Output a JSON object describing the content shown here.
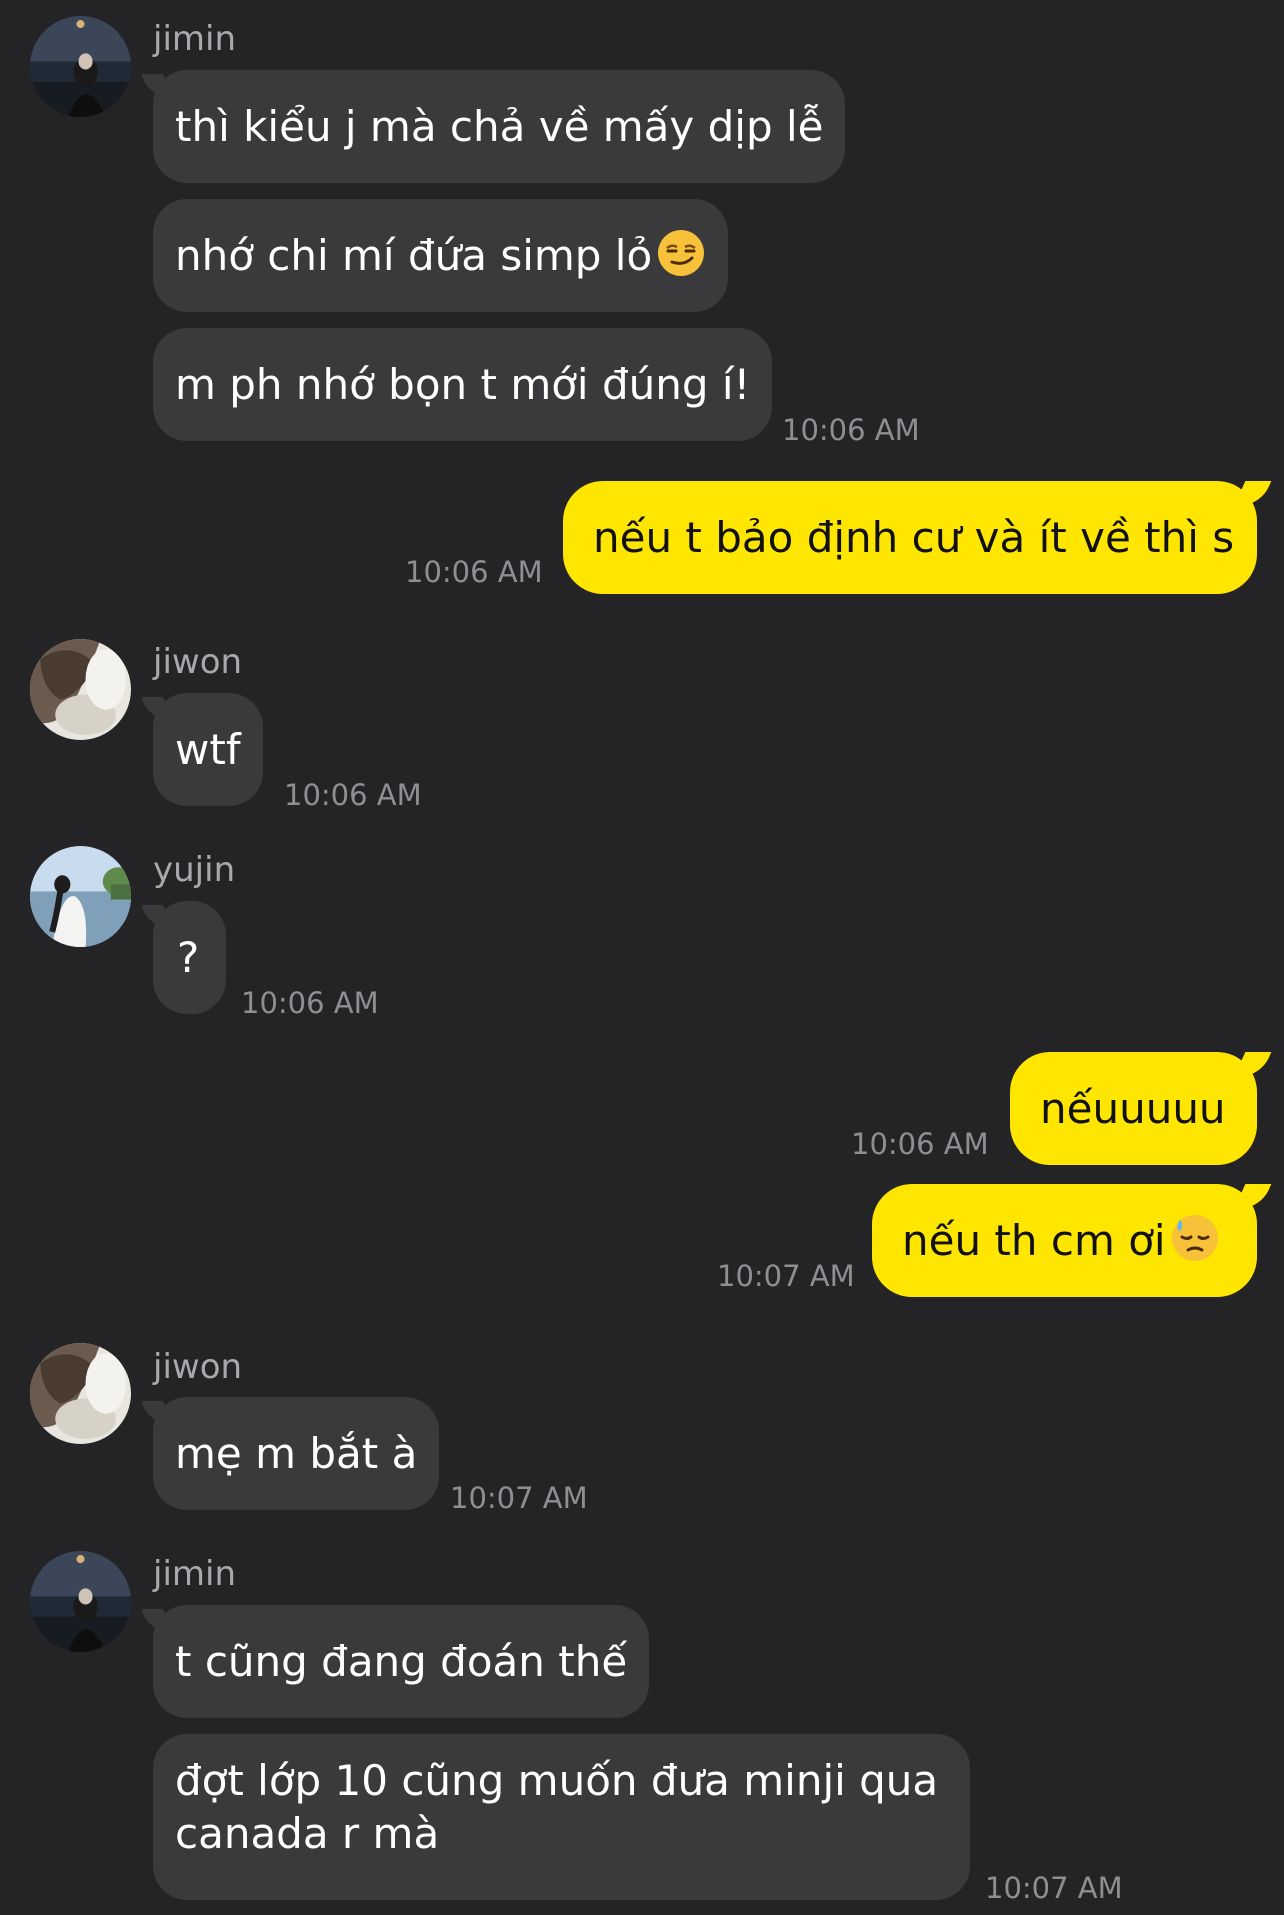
{
  "messages": [
    {
      "sender": "jimin",
      "lines": [
        "thì kiểu j mà chả về mấy dịp lễ",
        "nhớ chi mí đứa simp lỏ",
        "m ph nhớ bọn t mới đúng í!"
      ],
      "time": "10:06 AM",
      "emoji_after_line_2": "smirking-face-emoji"
    },
    {
      "sender": "me",
      "text": "nếu t bảo định cư và ít về thì s",
      "time": "10:06 AM"
    },
    {
      "sender": "jiwon",
      "text": "wtf",
      "time": "10:06 AM"
    },
    {
      "sender": "yujin",
      "text": "?",
      "time": "10:06 AM"
    },
    {
      "sender": "me",
      "text": "nếuuuuu",
      "time": "10:06 AM"
    },
    {
      "sender": "me",
      "text": "nếu th cm ơi",
      "time": "10:07 AM",
      "emoji": "downcast-face-with-sweat-emoji"
    },
    {
      "sender": "jiwon",
      "text": "mẹ m bắt à",
      "time": "10:07 AM"
    },
    {
      "sender": "jimin",
      "lines": [
        "t cũng đang đoán thế",
        "đợt lớp 10 cũng muốn đưa minji qua canada r mà"
      ],
      "time": "10:07 AM"
    }
  ],
  "colors": {
    "background": "#242426",
    "incoming_bubble": "#3a3a3d",
    "outgoing_bubble": "#ffe600",
    "time": "#8e8e93",
    "sender": "#a9a9ad"
  }
}
